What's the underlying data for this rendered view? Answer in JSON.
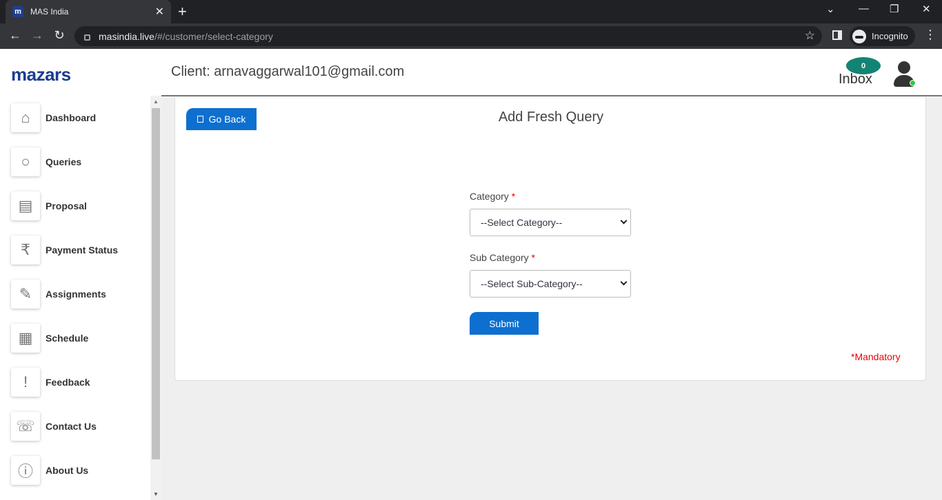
{
  "browser": {
    "tab_title": "MAS India",
    "tab_favicon": "m",
    "url_host": "masindia.live",
    "url_path": "/#/customer/select-category",
    "incognito_label": "Incognito"
  },
  "header": {
    "logo": "mazars",
    "client_text": "Client: arnavaggarwal101@gmail.com",
    "inbox_count": "0",
    "inbox_label": "Inbox",
    "online_color": "#2ecc40"
  },
  "sidebar": {
    "items": [
      {
        "label": "Dashboard",
        "icon": "home-icon"
      },
      {
        "label": "Queries",
        "icon": "search-icon"
      },
      {
        "label": "Proposal",
        "icon": "proposal-icon"
      },
      {
        "label": "Payment Status",
        "icon": "rupee-refresh-icon"
      },
      {
        "label": "Assignments",
        "icon": "document-edit-icon"
      },
      {
        "label": "Schedule",
        "icon": "calendar-clock-icon"
      },
      {
        "label": "Feedback",
        "icon": "feedback-icon"
      },
      {
        "label": "Contact Us",
        "icon": "contact-book-icon"
      },
      {
        "label": "About Us",
        "icon": "info-icon"
      }
    ]
  },
  "form": {
    "go_back_label": "Go Back",
    "title": "Add Fresh Query",
    "category_label": "Category",
    "category_value": "--Select Category--",
    "subcategory_label": "Sub Category",
    "subcategory_value": "--Select Sub-Category--",
    "required_mark": "*",
    "submit_label": "Submit",
    "mandatory_note": "*Mandatory"
  },
  "colors": {
    "primary": "#0d6fcf",
    "brand": "#1b3d8f",
    "inbox_badge": "#138473",
    "required": "#e00000"
  }
}
